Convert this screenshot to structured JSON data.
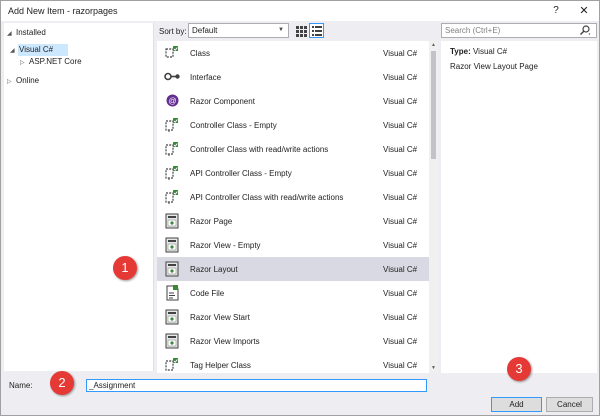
{
  "window": {
    "title": "Add New Item - razorpages",
    "help_label": "?",
    "close_label": "✕"
  },
  "tree": {
    "installed": "Installed",
    "visual_csharp": "Visual C#",
    "aspnet_core": "ASP.NET Core",
    "online": "Online"
  },
  "toolbar": {
    "sort_label": "Sort by:",
    "sort_value": "Default",
    "search_placeholder": "Search (Ctrl+E)"
  },
  "templates": [
    {
      "name": "Class",
      "lang": "Visual C#",
      "icon": "class-icon"
    },
    {
      "name": "Interface",
      "lang": "Visual C#",
      "icon": "interface-icon"
    },
    {
      "name": "Razor Component",
      "lang": "Visual C#",
      "icon": "razor-component-icon"
    },
    {
      "name": "Controller Class - Empty",
      "lang": "Visual C#",
      "icon": "controller-icon"
    },
    {
      "name": "Controller Class with read/write actions",
      "lang": "Visual C#",
      "icon": "controller-icon"
    },
    {
      "name": "API Controller Class - Empty",
      "lang": "Visual C#",
      "icon": "api-controller-icon"
    },
    {
      "name": "API Controller Class with read/write actions",
      "lang": "Visual C#",
      "icon": "api-controller-icon"
    },
    {
      "name": "Razor Page",
      "lang": "Visual C#",
      "icon": "razor-page-icon"
    },
    {
      "name": "Razor View - Empty",
      "lang": "Visual C#",
      "icon": "razor-view-icon"
    },
    {
      "name": "Razor Layout",
      "lang": "Visual C#",
      "icon": "razor-layout-icon",
      "selected": true
    },
    {
      "name": "Code File",
      "lang": "Visual C#",
      "icon": "code-file-icon"
    },
    {
      "name": "Razor View Start",
      "lang": "Visual C#",
      "icon": "razor-view-start-icon"
    },
    {
      "name": "Razor View Imports",
      "lang": "Visual C#",
      "icon": "razor-view-imports-icon"
    },
    {
      "name": "Tag Helper Class",
      "lang": "Visual C#",
      "icon": "tag-helper-icon"
    }
  ],
  "details": {
    "type_label": "Type:",
    "type_value": "Visual C#",
    "description": "Razor View Layout Page"
  },
  "name_field": {
    "label": "Name:",
    "value": "_Assignment"
  },
  "buttons": {
    "add": "Add",
    "cancel": "Cancel"
  },
  "callouts": [
    "1",
    "2",
    "3"
  ],
  "colors": {
    "accent": "#3399ff",
    "selected_row": "#d9d9e3",
    "callout": "#e53935",
    "icon_green": "#388a34",
    "icon_dark": "#424242",
    "razor_purple": "#652d90"
  }
}
